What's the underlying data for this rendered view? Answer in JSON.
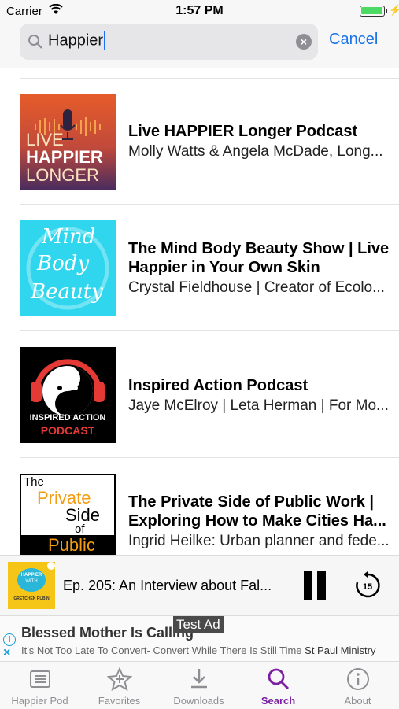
{
  "status_bar": {
    "carrier": "Carrier",
    "time": "1:57 PM"
  },
  "search": {
    "query": "Happier",
    "cancel_label": "Cancel"
  },
  "results": [
    {
      "title": "Live HAPPIER Longer Podcast",
      "subtitle": "Molly Watts & Angela McDade, Long...",
      "art_lines": [
        "LIVE",
        "HAPPIER",
        "LONGER"
      ]
    },
    {
      "title": "The Mind Body Beauty Show | Live",
      "title2": "Happier in Your Own Skin",
      "subtitle": "Crystal Fieldhouse | Creator of Ecolo...",
      "art_lines": [
        "Mind",
        "Body",
        "Beauty"
      ]
    },
    {
      "title": "Inspired Action Podcast",
      "subtitle": "Jaye McElroy | Leta Herman | For Mo...",
      "art_lines": [
        "INSPIRED ACTION",
        "PODCAST"
      ]
    },
    {
      "title": "The Private Side of Public Work |",
      "title2": "Exploring How to Make Cities Ha...",
      "subtitle": "Ingrid Heilke: Urban planner and fede...",
      "art_lines": [
        "The",
        "Private",
        "Side",
        "of",
        "Public"
      ]
    }
  ],
  "player": {
    "episode": "Ep. 205: An Interview about Fal...",
    "skip_seconds": "15",
    "thumb_lines": [
      "HAPPIER",
      "WITH",
      "GRETCHEN RUBIN"
    ]
  },
  "ad": {
    "headline": "Blessed Mother Is Calling",
    "body": "It's Not Too Late To Convert- Convert While There Is Still Time",
    "advertiser": "St Paul Ministry",
    "test_label": "Test Ad"
  },
  "tabs": [
    {
      "label": "Happier Pod",
      "icon": "list-icon",
      "active": false
    },
    {
      "label": "Favorites",
      "icon": "star-icon",
      "active": false
    },
    {
      "label": "Downloads",
      "icon": "download-icon",
      "active": false
    },
    {
      "label": "Search",
      "icon": "search-icon",
      "active": true
    },
    {
      "label": "About",
      "icon": "info-icon",
      "active": false
    }
  ],
  "colors": {
    "accent": "#1a73e8",
    "active_tab": "#7b1fa2",
    "inactive_tab": "#8e8e93"
  }
}
